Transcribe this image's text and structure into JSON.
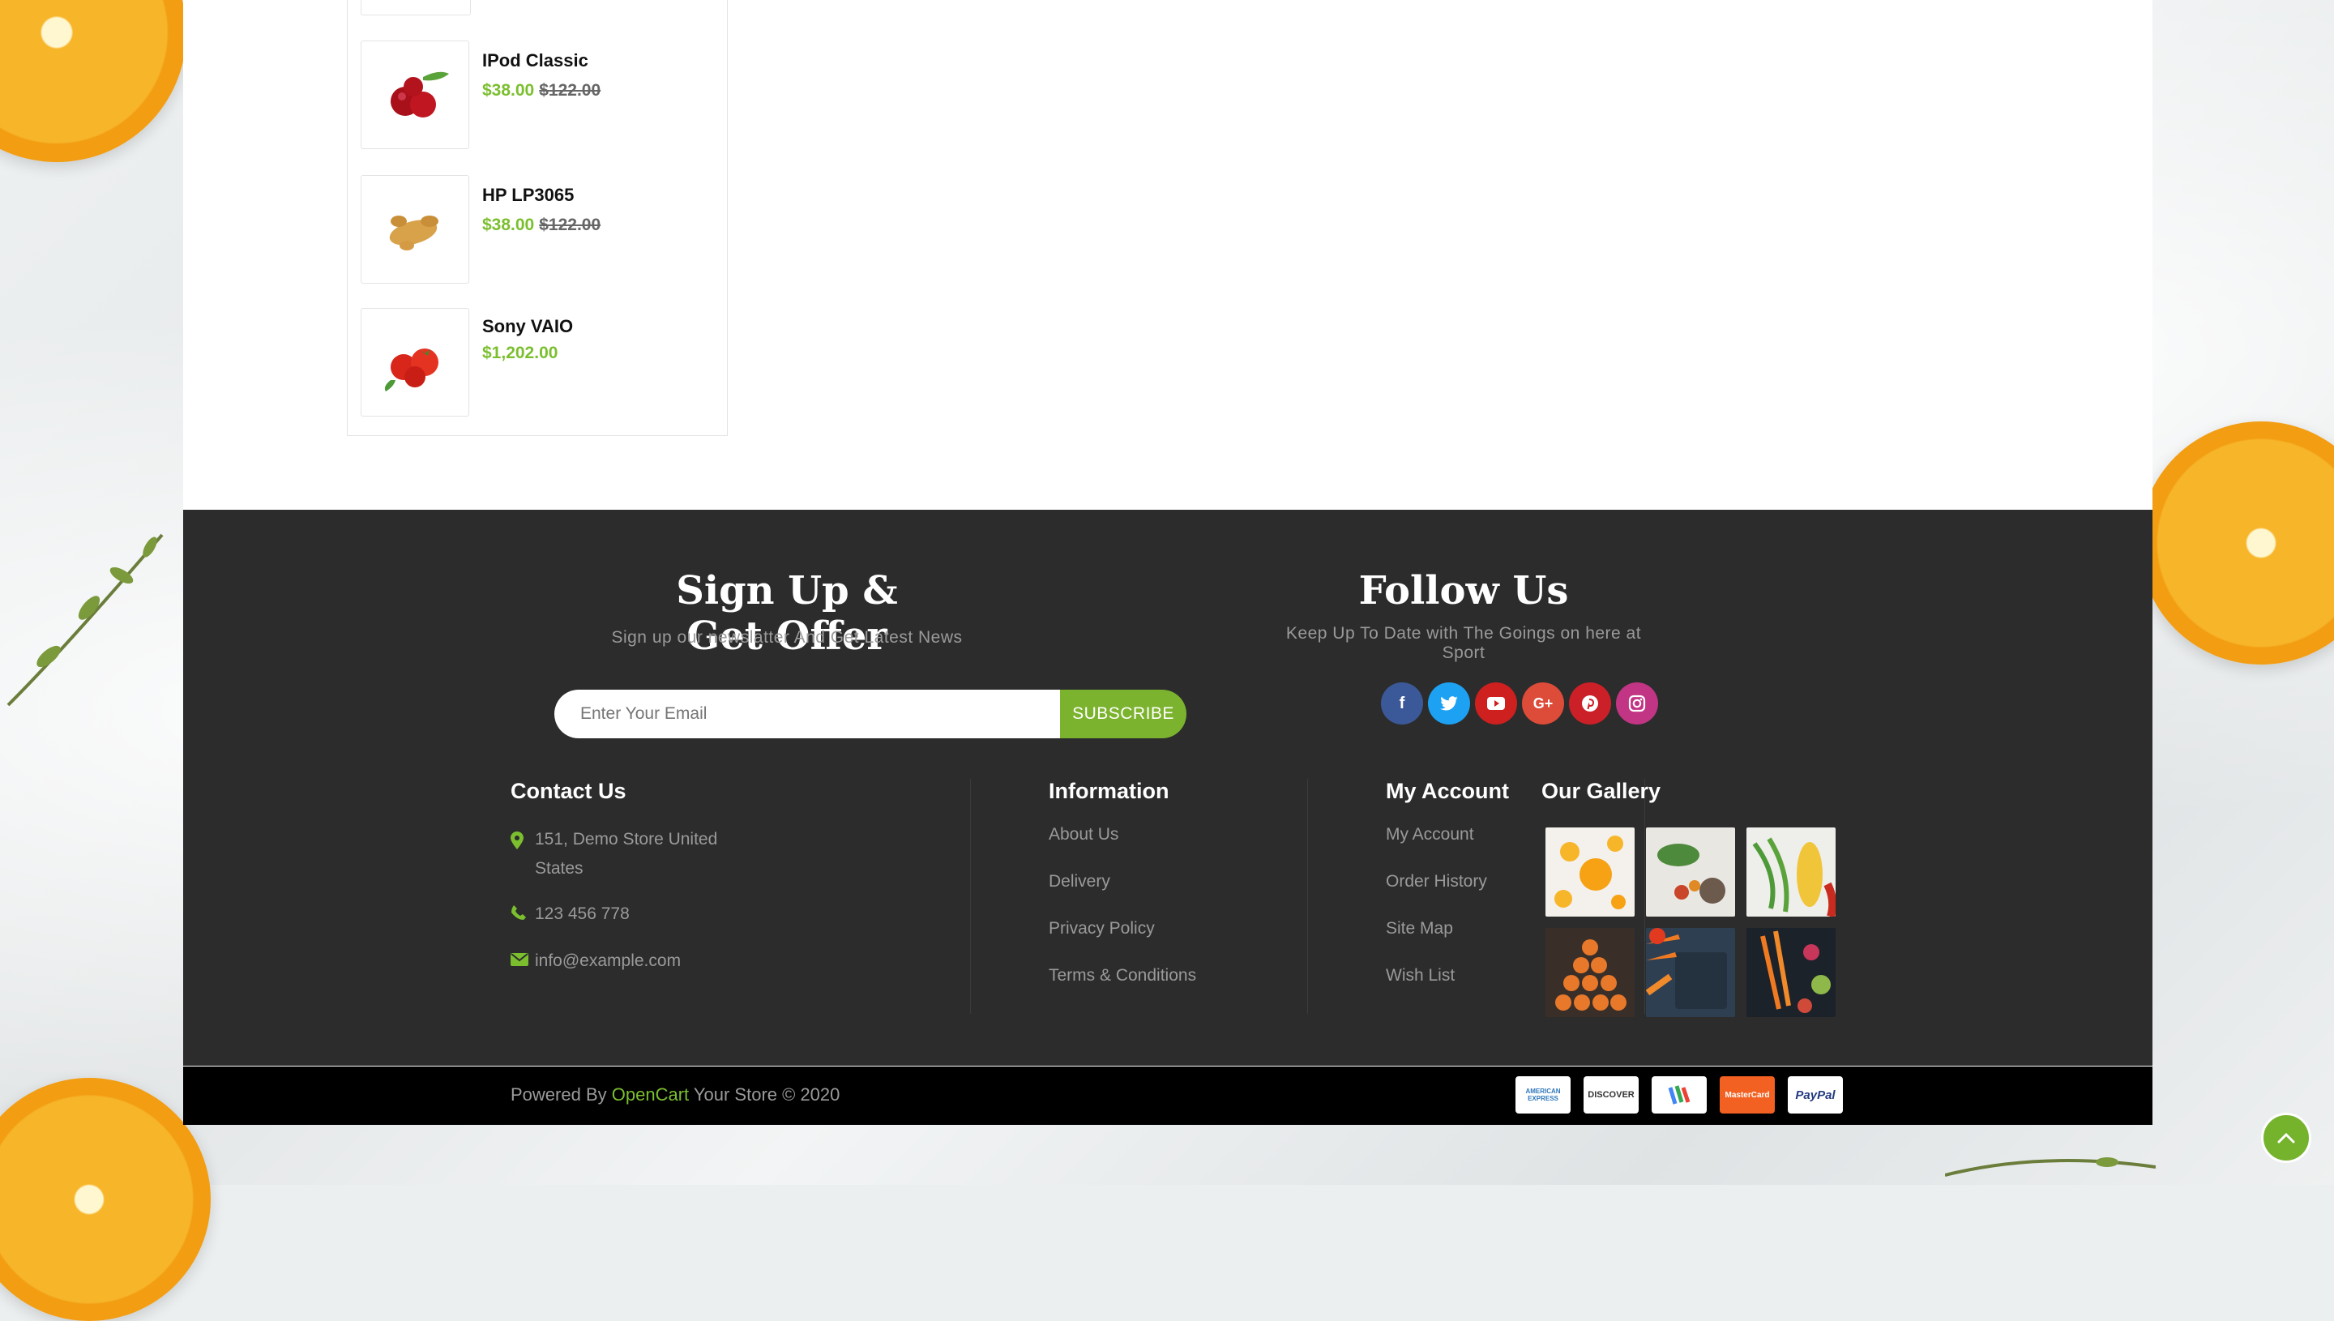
{
  "sidebar": {
    "products": [
      {
        "name": "IPod Classic",
        "price": "$38.00",
        "old_price": "$122.00",
        "image": "cherries"
      },
      {
        "name": "HP LP3065",
        "price": "$38.00",
        "old_price": "$122.00",
        "image": "ginger"
      },
      {
        "name": "Sony VAIO",
        "price": "$1,202.00",
        "old_price": "",
        "image": "tomatoes"
      }
    ]
  },
  "newsletter": {
    "title": "Sign Up & Get Offer",
    "subtitle": "Sign up our newslatter And Get Latest News",
    "email_placeholder": "Enter Your Email",
    "subscribe_label": "SUBSCRIBE"
  },
  "follow": {
    "title": "Follow Us",
    "subtitle": "Keep Up To Date with The Goings on here at Sport",
    "icons": [
      {
        "name": "facebook-icon",
        "glyph": "f",
        "color": "#3b5998"
      },
      {
        "name": "twitter-icon",
        "glyph": "t",
        "color": "#1da1f2"
      },
      {
        "name": "youtube-icon",
        "glyph": "▶",
        "color": "#cd201f"
      },
      {
        "name": "google-plus-icon",
        "glyph": "G+",
        "color": "#dd4b39"
      },
      {
        "name": "pinterest-icon",
        "glyph": "P",
        "color": "#cb2027"
      },
      {
        "name": "instagram-icon",
        "glyph": "◎",
        "color": "#c13584"
      }
    ]
  },
  "contact": {
    "title": "Contact Us",
    "address": "151, Demo Store United States",
    "phone": "123 456 778",
    "email": "info@example.com"
  },
  "information": {
    "title": "Information",
    "links": [
      "About Us",
      "Delivery",
      "Privacy Policy",
      "Terms & Conditions"
    ]
  },
  "account": {
    "title": "My Account",
    "links": [
      "My Account",
      "Order History",
      "Site Map",
      "Wish List"
    ]
  },
  "gallery": {
    "title": "Our Gallery",
    "images": [
      "oranges",
      "greens",
      "beans-corn",
      "orange-slices",
      "carrots-board",
      "carrots-radish"
    ]
  },
  "bottom": {
    "powered_prefix": "Powered By",
    "brand": "OpenCart",
    "suffix": "Your Store © 2020",
    "payments": [
      "AMERICAN EXPRESS",
      "DISCOVER",
      "GOOGLE",
      "MasterCard",
      "PayPal"
    ]
  },
  "colors": {
    "accent": "#7bbf2f",
    "footer_bg": "#2c2c2c",
    "bottom_bg": "#000000"
  }
}
